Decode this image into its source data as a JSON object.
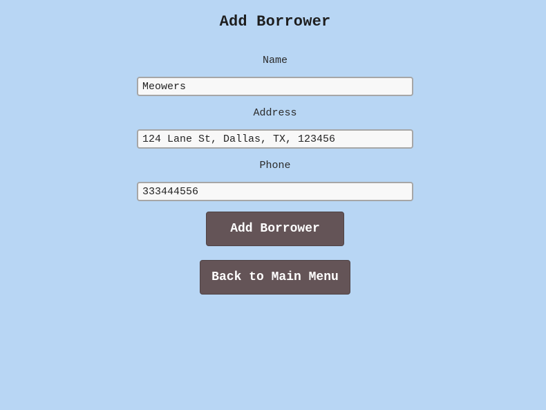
{
  "page": {
    "title": "Add Borrower"
  },
  "form": {
    "name": {
      "label": "Name",
      "value": "Meowers"
    },
    "address": {
      "label": "Address",
      "value": "124 Lane St, Dallas, TX, 123456"
    },
    "phone": {
      "label": "Phone",
      "value": "333444556"
    }
  },
  "buttons": {
    "add_label": "Add Borrower",
    "back_label": "Back to Main Menu"
  },
  "colors": {
    "background": "#b8d6f4",
    "button": "#645457",
    "input_background": "#f8f8f8",
    "input_border": "#a6a6a6"
  }
}
